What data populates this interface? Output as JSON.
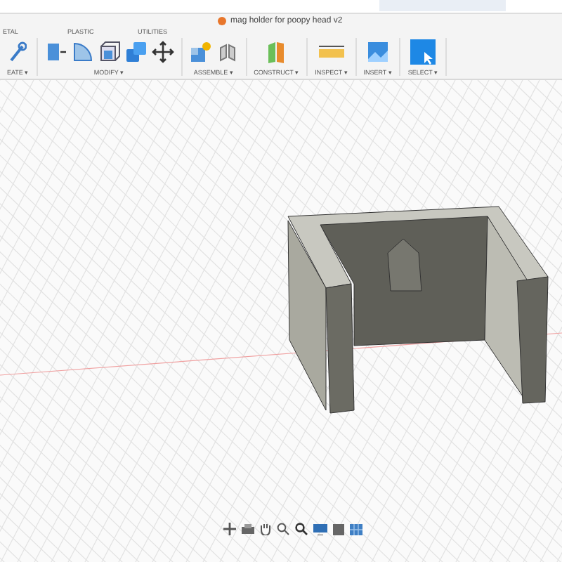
{
  "document": {
    "title": "mag holder for poopy head v2"
  },
  "tabs": [
    {
      "label": "ETAL"
    },
    {
      "label": "PLASTIC"
    },
    {
      "label": "UTILITIES"
    }
  ],
  "groups": [
    {
      "label": "EATE ▾"
    },
    {
      "label": "MODIFY ▾"
    },
    {
      "label": "ASSEMBLE ▾"
    },
    {
      "label": "CONSTRUCT ▾"
    },
    {
      "label": "INSPECT ▾"
    },
    {
      "label": "INSERT ▾"
    },
    {
      "label": "SELECT ▾"
    }
  ]
}
